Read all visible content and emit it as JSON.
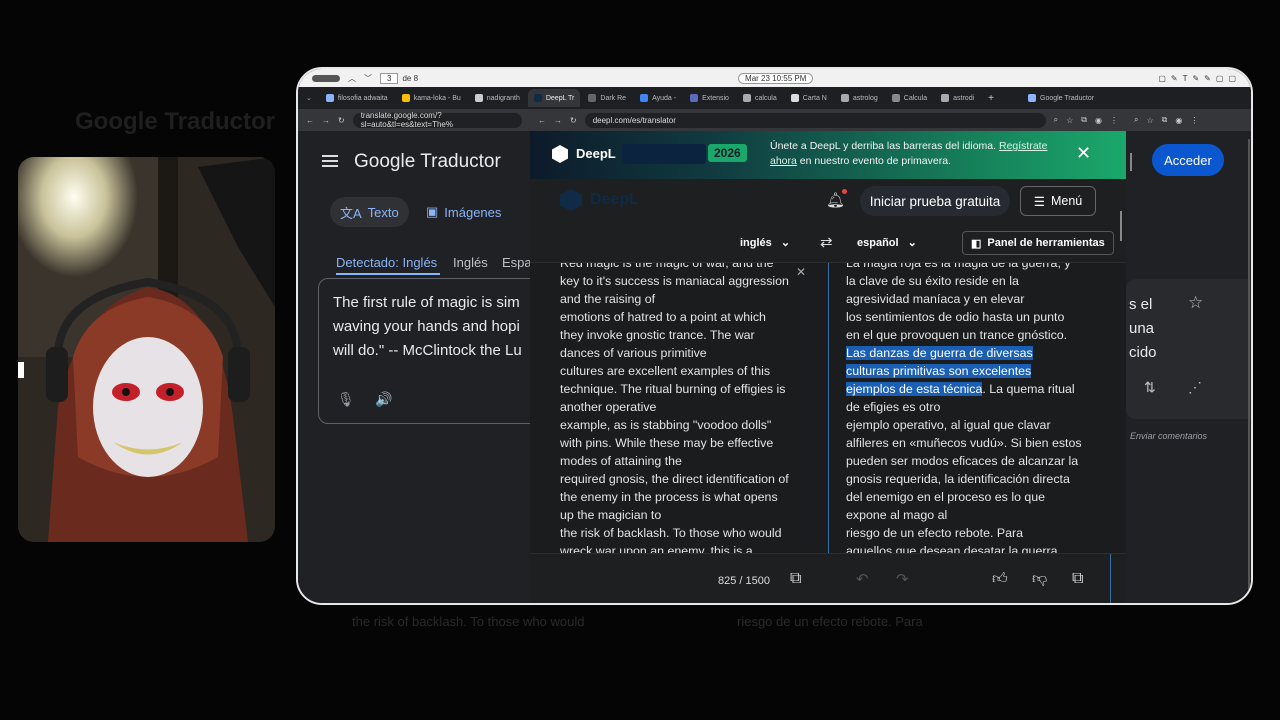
{
  "background": {
    "faded_title": "Google Traductor",
    "faded_lines": [
      "the risk of backlash. To those who would",
      "riesgo de un efecto rebote. Para"
    ]
  },
  "os_bar": {
    "page_num": "3",
    "page_of": "de 8",
    "datetime": "Mar 23  10:55 PM"
  },
  "tabs": [
    {
      "label": "filosofia adwaita"
    },
    {
      "label": "kama-loka - Bu"
    },
    {
      "label": "nadigranth"
    },
    {
      "label": "DeepL Tr",
      "active": true
    },
    {
      "label": "Dark Re"
    },
    {
      "label": "Ayuda -"
    },
    {
      "label": "Extensio"
    },
    {
      "label": "calcula"
    },
    {
      "label": "Carta N"
    },
    {
      "label": "astrolog"
    },
    {
      "label": "Calcula"
    },
    {
      "label": "astrodi"
    },
    {
      "label": "Google Traductor"
    }
  ],
  "address": {
    "gt_url": "translate.google.com/?sl=auto&tl=es&text=The%",
    "deepl_url": "deepl.com/es/translator"
  },
  "google_translate": {
    "logo_google": "Google",
    "logo_product": "Traductor",
    "tab_text": "Texto",
    "tab_images": "Imágenes",
    "lang_detected": "Detectado: Inglés",
    "lang_english": "Inglés",
    "lang_spanish": "Espa",
    "source_text": "The first rule of magic is sim waving your hands and hopi will do.\" -- McClintock the Lu",
    "signin": "Acceder",
    "output_fragment_1": "s el",
    "output_fragment_2": "una",
    "output_fragment_3": "cido",
    "feedback": "Enviar comentarios"
  },
  "deepl": {
    "banner_brand": "DeepL",
    "banner_year": "2026",
    "banner_text": "Únete a DeepL y derriba las barreras del idioma.",
    "banner_link": "Regístrate ahora",
    "banner_text_after": "en nuestro evento de primavera.",
    "logo": "DeepL",
    "trial_button": "Iniciar prueba gratuita",
    "menu_button": "Menú",
    "source_lang": "inglés",
    "target_lang": "español",
    "tools_button": "Panel de herramientas",
    "source_lines": [
      "Red magic is the magic of war, and the",
      "key to it's success is maniacal aggression",
      "and the raising of",
      "emotions of hatred to a point at which",
      "they invoke gnostic trance. The war",
      "dances of various primitive",
      "cultures are excellent examples of this",
      "technique. The ritual burning of effigies is",
      "another operative",
      "example, as is stabbing \"voodoo dolls\"",
      "with pins. While these may be effective",
      "modes of attaining the",
      "required gnosis, the direct identification of",
      "the enemy in the process is what opens",
      "up the magician to",
      "the risk of backlash. To those who would",
      "wreck war upon an enemy, this is a"
    ],
    "target_lines": [
      {
        "text": "La magia roja es la magia de la guerra, y"
      },
      {
        "text": "la clave de su éxito reside en la"
      },
      {
        "text": "agresividad maníaca y en elevar"
      },
      {
        "text": "los sentimientos de odio hasta un punto"
      },
      {
        "text": "en el que provoquen un trance gnóstico."
      },
      {
        "text": "Las danzas de guerra de diversas",
        "hl": "Las danzas de guerra de diversas"
      },
      {
        "text": "culturas primitivas son excelentes",
        "hl": "culturas primitivas son excelentes"
      },
      {
        "text": "ejemplos de esta técnica. La quema ritual",
        "hl": "ejemplos de esta técnica",
        "rest": ". La quema ritual"
      },
      {
        "text": "de efigies es otro"
      },
      {
        "text": "ejemplo operativo, al igual que clavar"
      },
      {
        "text": "alfileres en «muñecos vudú». Si bien estos"
      },
      {
        "text": "pueden ser modos eficaces de alcanzar la"
      },
      {
        "text": "gnosis requerida, la identificación directa"
      },
      {
        "text": "del enemigo en el proceso es lo que"
      },
      {
        "text": "expone al mago al"
      },
      {
        "text": "riesgo de un efecto rebote. Para"
      },
      {
        "text": "aquellos que desean desatar la guerra"
      }
    ],
    "char_count": "825 / 1500"
  },
  "colors": {
    "accent_blue": "#1a5fb4",
    "signin_blue": "#0b57d0",
    "banner_green": "#1aa86a"
  }
}
